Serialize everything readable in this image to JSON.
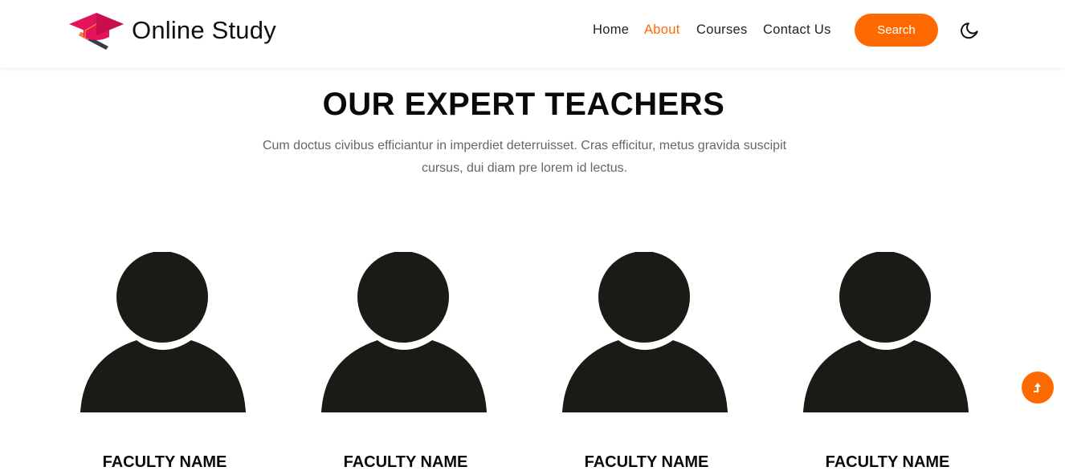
{
  "brand": {
    "name": "Online Study",
    "logo_icon": "graduation-cap-icon",
    "logo_color": "#e5135a"
  },
  "nav": {
    "items": [
      {
        "label": "Home",
        "active": false
      },
      {
        "label": "About",
        "active": true
      },
      {
        "label": "Courses",
        "active": false
      },
      {
        "label": "Contact Us",
        "active": false
      }
    ],
    "search_label": "Search",
    "theme_toggle_icon": "moon-icon"
  },
  "section": {
    "title": "OUR EXPERT TEACHERS",
    "subtitle": "Cum doctus civibus efficiantur in imperdiet deterruisset. Cras efficitur, metus gravida suscipit cursus, dui diam pre lorem id lectus."
  },
  "teachers": [
    {
      "name": "FACULTY NAME",
      "avatar_icon": "user-silhouette-icon"
    },
    {
      "name": "FACULTY NAME",
      "avatar_icon": "user-silhouette-icon"
    },
    {
      "name": "FACULTY NAME",
      "avatar_icon": "user-silhouette-icon"
    },
    {
      "name": "FACULTY NAME",
      "avatar_icon": "user-silhouette-icon"
    }
  ],
  "scroll_top": {
    "icon": "arrow-up-icon"
  },
  "colors": {
    "accent": "#ff6a00",
    "avatar": "#1b1b16",
    "text": "#0a0a0a",
    "muted": "#666666"
  }
}
